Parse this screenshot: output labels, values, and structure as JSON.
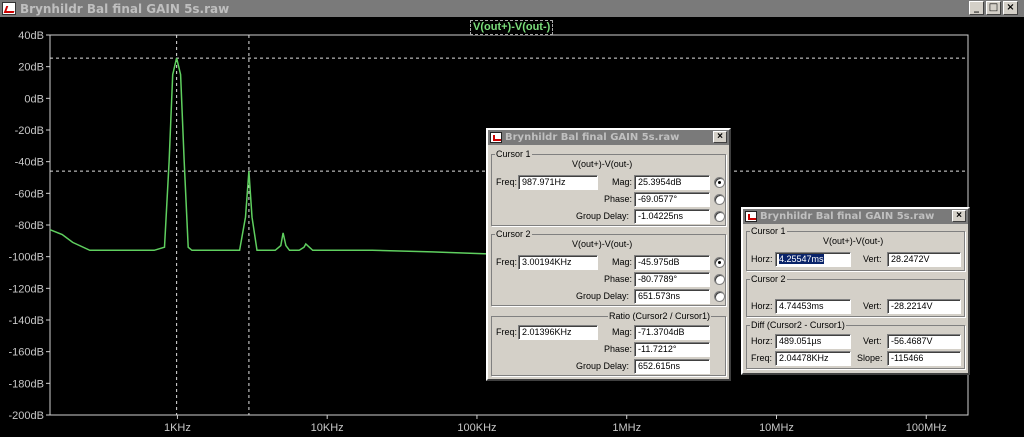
{
  "window": {
    "title": "Brynhildr Bal final GAIN 5s.raw",
    "buttons": [
      "_",
      "□",
      "×"
    ]
  },
  "plot": {
    "trace_label": "V(out+)-V(out-)",
    "y_ticks": [
      "40dB",
      "20dB",
      "0dB",
      "-20dB",
      "-40dB",
      "-60dB",
      "-80dB",
      "-100dB",
      "-120dB",
      "-140dB",
      "-160dB",
      "-180dB",
      "-200dB"
    ],
    "x_ticks": [
      "1KHz",
      "10KHz",
      "100KHz",
      "1MHz",
      "10MHz",
      "100MHz"
    ],
    "background": "#000000",
    "trace_color": "#5fcf5f",
    "grid_color": "#d0d0d0"
  },
  "chart_data": {
    "type": "line",
    "title": "",
    "xlabel": "",
    "ylabel": "",
    "x_scale": "log",
    "xlim": [
      141,
      190000000
    ],
    "ylim": [
      -200,
      40
    ],
    "series": [
      {
        "name": "V(out+)-V(out-)",
        "x": [
          141,
          170,
          200,
          260,
          320,
          500,
          700,
          820,
          880,
          930,
          987.971,
          1050,
          1110,
          1180,
          1250,
          1800,
          2600,
          2850,
          3001.94,
          3150,
          3400,
          4500,
          4900,
          5080,
          5300,
          5600,
          6500,
          7000,
          7200,
          8000,
          12000,
          20000,
          50000,
          100000,
          200000,
          400000
        ],
        "y": [
          -83,
          -86,
          -91,
          -96,
          -96,
          -96,
          -96,
          -94,
          -40,
          15,
          25.4,
          15,
          -40,
          -94,
          -96,
          -96,
          -96,
          -75,
          -46,
          -75,
          -96,
          -96,
          -93,
          -85,
          -93,
          -96,
          -96,
          -94,
          -92,
          -96,
          -96,
          -96,
          -97,
          -98,
          -99,
          -100
        ]
      }
    ],
    "cursors": [
      {
        "x": 987.971,
        "y": 25.3954
      },
      {
        "x": 3001.94,
        "y": -45.975
      }
    ]
  },
  "dialog1": {
    "title": "Brynhildr Bal final GAIN 5s.raw",
    "close": "×",
    "cursor1": {
      "legend": "Cursor 1",
      "expr": "V(out+)-V(out-)",
      "freq_label": "Freq:",
      "freq": "987.971Hz",
      "mag_label": "Mag:",
      "mag": "25.3954dB",
      "phase_label": "Phase:",
      "phase": "-69.0577°",
      "gd_label": "Group Delay:",
      "gd": "-1.04225ns"
    },
    "cursor2": {
      "legend": "Cursor 2",
      "expr": "V(out+)-V(out-)",
      "freq_label": "Freq:",
      "freq": "3.00194KHz",
      "mag_label": "Mag:",
      "mag": "-45.975dB",
      "phase_label": "Phase:",
      "phase": "-80.7789°",
      "gd_label": "Group Delay:",
      "gd": "651.573ns"
    },
    "ratio": {
      "legend": "Ratio (Cursor2 / Cursor1)",
      "freq_label": "Freq:",
      "freq": "2.01396KHz",
      "mag_label": "Mag:",
      "mag": "-71.3704dB",
      "phase_label": "Phase:",
      "phase": "-11.7212°",
      "gd_label": "Group Delay:",
      "gd": "652.615ns"
    }
  },
  "dialog2": {
    "title": "Brynhildr Bal final GAIN 5s.raw",
    "close": "×",
    "cursor1": {
      "legend": "Cursor 1",
      "expr": "V(out+)-V(out-)",
      "horz_label": "Horz:",
      "horz": "4.25547ms",
      "vert_label": "Vert:",
      "vert": "28.2472V"
    },
    "cursor2": {
      "legend": "Cursor 2",
      "expr": "V(out+)-V(out-)",
      "horz_label": "Horz:",
      "horz": "4.74453ms",
      "vert_label": "Vert:",
      "vert": "-28.2214V"
    },
    "diff": {
      "legend": "Diff (Cursor2 - Cursor1)",
      "horz_label": "Horz:",
      "horz": "489.051µs",
      "vert_label": "Vert:",
      "vert": "-56.4687V",
      "freq_label": "Freq:",
      "freq": "2.04478KHz",
      "slope_label": "Slope:",
      "slope": "-115466"
    }
  }
}
